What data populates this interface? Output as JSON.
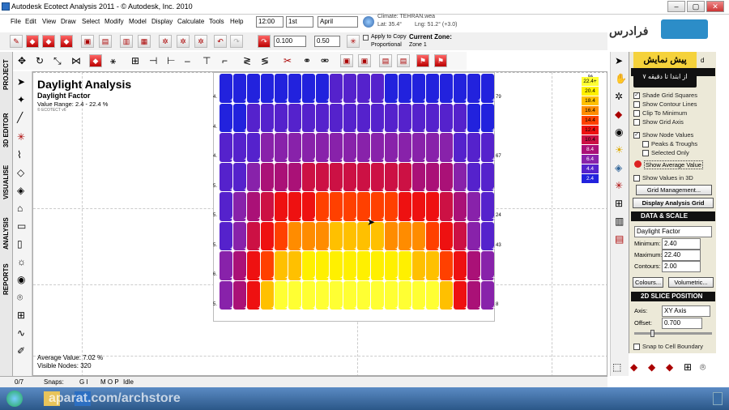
{
  "window": {
    "title": "Autodesk Ecotect Analysis 2011 - © Autodesk, Inc. 2010",
    "controls": [
      "–",
      "▢",
      "✕"
    ]
  },
  "menu": [
    "File",
    "Edit",
    "View",
    "Draw",
    "Select",
    "Modify",
    "Model",
    "Display",
    "Calculate",
    "Tools",
    "Help"
  ],
  "datetime": {
    "time": "12:00",
    "day": "1st",
    "month": "April"
  },
  "climate": {
    "label": "Climate: TEHRAN.wea",
    "lat": "Lat: 35.4°",
    "lng": "Lng: 51.2° (+3.0)"
  },
  "offsets": {
    "value1": "0.100",
    "value2": "0.50"
  },
  "apply_copy": "Apply to Copy",
  "proportional": "Proportional",
  "current_zone": {
    "label": "Current Zone:",
    "value": "Zone 1"
  },
  "left_tabs": [
    "PROJECT",
    "3D EDITOR",
    "VISUALISE",
    "ANALYSIS",
    "REPORTS"
  ],
  "analysis": {
    "title": "Daylight Analysis",
    "subtitle": "Daylight Factor",
    "range": "Value Range: 2.4 - 22.4 %",
    "credit": "© ECOTECT v6",
    "average": "Average Value: 7.02 %",
    "visible_nodes": "Visible Nodes: 320"
  },
  "legend": {
    "unit": "%",
    "entries": [
      {
        "value": "22.4+",
        "color": "#ffff33"
      },
      {
        "value": "20.4",
        "color": "#fff000"
      },
      {
        "value": "18.4",
        "color": "#ffc000"
      },
      {
        "value": "16.4",
        "color": "#ff8c00"
      },
      {
        "value": "14.4",
        "color": "#ff4000"
      },
      {
        "value": "12.4",
        "color": "#ee1111"
      },
      {
        "value": "10.4",
        "color": "#cc1144"
      },
      {
        "value": "8.4",
        "color": "#aa1177"
      },
      {
        "value": "6.4",
        "color": "#8822aa"
      },
      {
        "value": "4.4",
        "color": "#5522cc"
      },
      {
        "value": "2.4",
        "color": "#2222dd"
      }
    ]
  },
  "panel": {
    "header_label": "d",
    "checkboxes": [
      {
        "label": "Shade Grid Squares",
        "checked": true
      },
      {
        "label": "Show Contour Lines",
        "checked": false
      },
      {
        "label": "Clip To Minimum",
        "checked": false
      },
      {
        "label": "Show Grid Axis",
        "checked": false
      },
      {
        "label": "Show Node Values",
        "checked": true
      },
      {
        "label": "Peaks & Troughs",
        "checked": false
      },
      {
        "label": "Selected Only",
        "checked": false
      }
    ],
    "show_average": "Show Average Value",
    "show_values_3d": "Show Values in 3D",
    "grid_management": "Grid Management...",
    "display_grid": "Display Analysis Grid",
    "data_scale_header": "DATA & SCALE",
    "data_type": "Daylight Factor",
    "minimum_label": "Minimum:",
    "minimum": "2.40",
    "maximum_label": "Maximum:",
    "maximum": "22.40",
    "contours_label": "Contours:",
    "contours": "2.00",
    "colours": "Colours...",
    "volumetric": "Volumetric...",
    "slice_header": "2D SLICE POSITION",
    "axis_label": "Axis:",
    "axis_value": "XY Axis",
    "offset_label": "Offset:",
    "offset_value": "0.700",
    "snap_label": "Snap to Cell Boundary"
  },
  "promo": {
    "line1": "پیش نمایش",
    "line2": "از ابتدا تا دقیقه ۷"
  },
  "brand": "فرادرس",
  "status": {
    "count": "0/7",
    "snaps_label": "Snaps:",
    "snaps_1": "G I",
    "snaps_2": "M O P",
    "state": "Idle"
  },
  "watermark": "aparat.com/archstore",
  "grid": {
    "rows": 8,
    "cols": 20,
    "row_labels_left": [
      "4.",
      "4.",
      "4.",
      "5.",
      "5.",
      "5.",
      "6.",
      "5."
    ],
    "row_labels_right": [
      "79",
      "",
      "67",
      "",
      "24",
      "43",
      "",
      "8"
    ],
    "values": [
      [
        2.4,
        2.6,
        2.8,
        3.0,
        3.1,
        3.2,
        3.3,
        3.3,
        3.4,
        3.4,
        3.4,
        3.4,
        3.3,
        3.3,
        3.2,
        3.1,
        3.0,
        2.8,
        2.6,
        2.4
      ],
      [
        2.8,
        3.2,
        3.6,
        4.0,
        4.2,
        4.4,
        4.5,
        4.6,
        4.6,
        4.7,
        4.7,
        4.6,
        4.6,
        4.5,
        4.4,
        4.2,
        4.0,
        3.6,
        3.2,
        2.8
      ],
      [
        3.4,
        4.0,
        4.8,
        5.6,
        6.2,
        6.6,
        6.9,
        7.1,
        7.2,
        7.3,
        7.3,
        7.2,
        7.1,
        6.9,
        6.6,
        6.2,
        5.6,
        4.8,
        4.0,
        3.4
      ],
      [
        4.0,
        5.0,
        6.4,
        7.6,
        8.6,
        9.3,
        9.8,
        10.1,
        10.3,
        10.4,
        10.4,
        10.3,
        10.1,
        9.8,
        9.3,
        8.6,
        7.6,
        6.4,
        5.0,
        4.0
      ],
      [
        4.6,
        6.0,
        8.0,
        10.0,
        11.4,
        12.4,
        13.0,
        13.4,
        13.6,
        13.7,
        13.7,
        13.6,
        13.4,
        13.0,
        12.4,
        11.4,
        10.0,
        8.0,
        6.0,
        4.6
      ],
      [
        5.0,
        7.0,
        9.8,
        12.6,
        14.6,
        15.8,
        16.6,
        17.2,
        17.5,
        17.6,
        17.6,
        17.5,
        17.2,
        16.6,
        15.8,
        14.6,
        12.6,
        9.8,
        7.0,
        5.0
      ],
      [
        5.4,
        7.8,
        11.4,
        15.2,
        17.6,
        19.2,
        20.2,
        20.8,
        21.2,
        21.3,
        21.3,
        21.2,
        20.8,
        20.2,
        19.2,
        17.6,
        15.2,
        11.4,
        7.8,
        5.4
      ],
      [
        5.6,
        8.4,
        12.8,
        18.0,
        21.5,
        22.4,
        22.4,
        22.4,
        22.4,
        22.4,
        22.4,
        22.4,
        22.4,
        22.4,
        22.4,
        21.5,
        18.0,
        12.8,
        8.4,
        5.6
      ]
    ],
    "min": 2.4,
    "max": 22.4
  }
}
